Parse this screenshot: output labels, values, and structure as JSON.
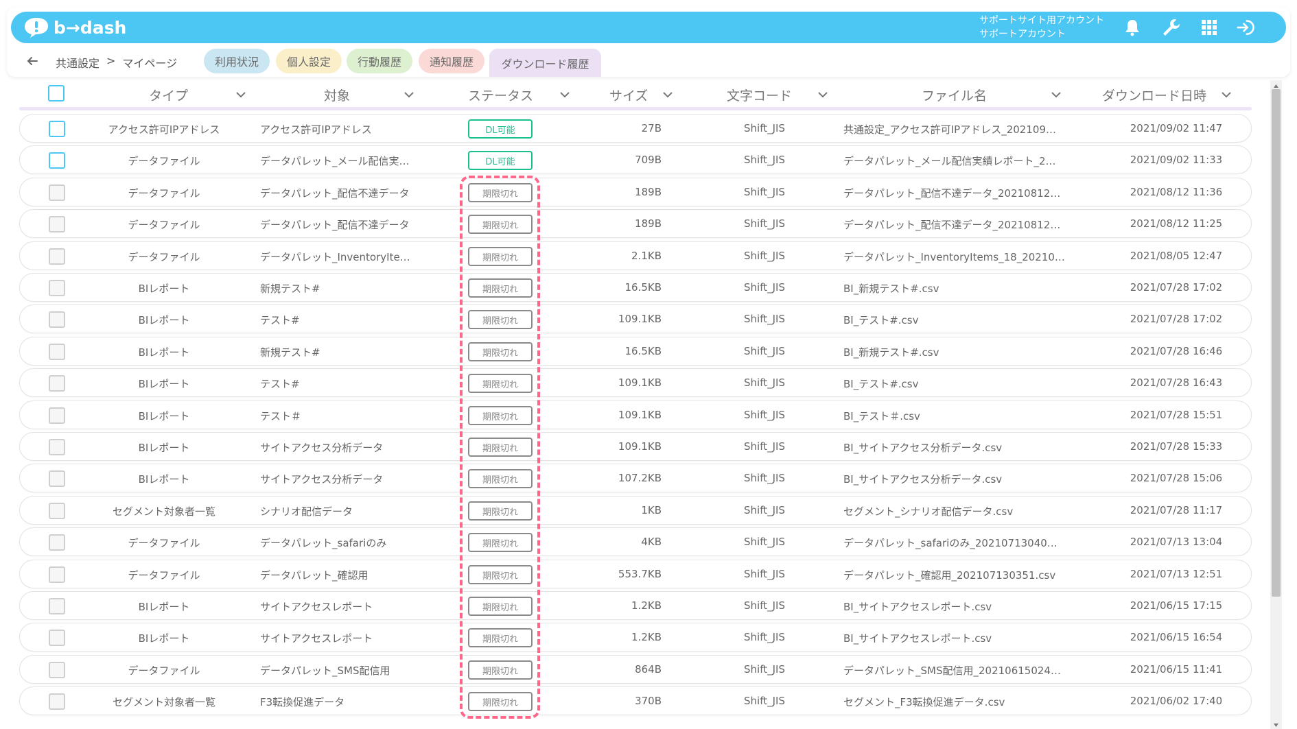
{
  "header": {
    "logo_text": "b→dash",
    "account_line1": "サポートサイト用アカウント",
    "account_line2": "サポートアカウント",
    "icons": [
      "bell-icon",
      "wrench-icon",
      "grid-icon",
      "logout-icon"
    ],
    "bar_color": "#4cc6f2"
  },
  "subnav": {
    "breadcrumb_parent": "共通設定",
    "breadcrumb_separator": ">",
    "breadcrumb_current": "マイページ",
    "tabs": [
      {
        "label": "利用状況",
        "color": "#c9e6f2"
      },
      {
        "label": "個人設定",
        "color": "#fbefc9"
      },
      {
        "label": "行動履歴",
        "color": "#ddf0cf"
      },
      {
        "label": "通知履歴",
        "color": "#fbd9d6"
      },
      {
        "label": "ダウンロード履歴",
        "color": "#ece0f5"
      }
    ]
  },
  "table": {
    "columns": {
      "type": "タイプ",
      "target": "対象",
      "status": "ステータス",
      "size": "サイズ",
      "encoding": "文字コード",
      "filename": "ファイル名",
      "datetime": "ダウンロード日時"
    },
    "rows": [
      {
        "type": "アクセス許可IPアドレス",
        "target": "アクセス許可IPアドレス",
        "status": "DL可能",
        "size": "27B",
        "encoding": "Shift_JIS",
        "filename": "共通設定_アクセス許可IPアドレス_202109…",
        "datetime": "2021/09/02 11:47"
      },
      {
        "type": "データファイル",
        "target": "データパレット_メール配信実…",
        "status": "DL可能",
        "size": "709B",
        "encoding": "Shift_JIS",
        "filename": "データパレット_メール配信実績レポート_2…",
        "datetime": "2021/09/02 11:33"
      },
      {
        "type": "データファイル",
        "target": "データパレット_配信不達データ",
        "status": "期限切れ",
        "size": "189B",
        "encoding": "Shift_JIS",
        "filename": "データパレット_配信不達データ_20210812…",
        "datetime": "2021/08/12 11:36"
      },
      {
        "type": "データファイル",
        "target": "データパレット_配信不達データ",
        "status": "期限切れ",
        "size": "189B",
        "encoding": "Shift_JIS",
        "filename": "データパレット_配信不達データ_20210812…",
        "datetime": "2021/08/12 11:25"
      },
      {
        "type": "データファイル",
        "target": "データパレット_InventoryIte…",
        "status": "期限切れ",
        "size": "2.1KB",
        "encoding": "Shift_JIS",
        "filename": "データパレット_InventoryItems_18_20210…",
        "datetime": "2021/08/05 12:47"
      },
      {
        "type": "BIレポート",
        "target": "新規テスト#",
        "status": "期限切れ",
        "size": "16.5KB",
        "encoding": "Shift_JIS",
        "filename": "BI_新規テスト#.csv",
        "datetime": "2021/07/28 17:02"
      },
      {
        "type": "BIレポート",
        "target": "テスト#",
        "status": "期限切れ",
        "size": "109.1KB",
        "encoding": "Shift_JIS",
        "filename": "BI_テスト#.csv",
        "datetime": "2021/07/28 17:02"
      },
      {
        "type": "BIレポート",
        "target": "新規テスト#",
        "status": "期限切れ",
        "size": "16.5KB",
        "encoding": "Shift_JIS",
        "filename": "BI_新規テスト#.csv",
        "datetime": "2021/07/28 16:46"
      },
      {
        "type": "BIレポート",
        "target": "テスト#",
        "status": "期限切れ",
        "size": "109.1KB",
        "encoding": "Shift_JIS",
        "filename": "BI_テスト#.csv",
        "datetime": "2021/07/28 16:43"
      },
      {
        "type": "BIレポート",
        "target": "テスト＃",
        "status": "期限切れ",
        "size": "109.1KB",
        "encoding": "Shift_JIS",
        "filename": "BI_テスト＃.csv",
        "datetime": "2021/07/28 15:51"
      },
      {
        "type": "BIレポート",
        "target": "サイトアクセス分析データ",
        "status": "期限切れ",
        "size": "109.1KB",
        "encoding": "Shift_JIS",
        "filename": "BI_サイトアクセス分析データ.csv",
        "datetime": "2021/07/28 15:33"
      },
      {
        "type": "BIレポート",
        "target": "サイトアクセス分析データ",
        "status": "期限切れ",
        "size": "107.2KB",
        "encoding": "Shift_JIS",
        "filename": "BI_サイトアクセス分析データ.csv",
        "datetime": "2021/07/28 15:06"
      },
      {
        "type": "セグメント対象者一覧",
        "target": "シナリオ配信データ",
        "status": "期限切れ",
        "size": "1KB",
        "encoding": "Shift_JIS",
        "filename": "セグメント_シナリオ配信データ.csv",
        "datetime": "2021/07/28 11:17"
      },
      {
        "type": "データファイル",
        "target": "データパレット_safariのみ",
        "status": "期限切れ",
        "size": "4KB",
        "encoding": "Shift_JIS",
        "filename": "データパレット_safariのみ_20210713040…",
        "datetime": "2021/07/13 13:04"
      },
      {
        "type": "データファイル",
        "target": "データパレット_確認用",
        "status": "期限切れ",
        "size": "553.7KB",
        "encoding": "Shift_JIS",
        "filename": "データパレット_確認用_202107130351.csv",
        "datetime": "2021/07/13 12:51"
      },
      {
        "type": "BIレポート",
        "target": "サイトアクセスレポート",
        "status": "期限切れ",
        "size": "1.2KB",
        "encoding": "Shift_JIS",
        "filename": "BI_サイトアクセスレポート.csv",
        "datetime": "2021/06/15 17:15"
      },
      {
        "type": "BIレポート",
        "target": "サイトアクセスレポート",
        "status": "期限切れ",
        "size": "1.2KB",
        "encoding": "Shift_JIS",
        "filename": "BI_サイトアクセスレポート.csv",
        "datetime": "2021/06/15 16:54"
      },
      {
        "type": "データファイル",
        "target": "データパレット_SMS配信用",
        "status": "期限切れ",
        "size": "864B",
        "encoding": "Shift_JIS",
        "filename": "データパレット_SMS配信用_20210615024…",
        "datetime": "2021/06/15 11:41"
      },
      {
        "type": "セグメント対象者一覧",
        "target": "F3転換促進データ",
        "status": "期限切れ",
        "size": "370B",
        "encoding": "Shift_JIS",
        "filename": "セグメント_F3転換促進データ.csv",
        "datetime": "2021/06/02 17:40"
      }
    ]
  },
  "colors": {
    "accent": "#4cc6f2",
    "status_ok": "#19c08e",
    "status_expired": "#8a8a8a",
    "highlight": "#ff6688"
  }
}
